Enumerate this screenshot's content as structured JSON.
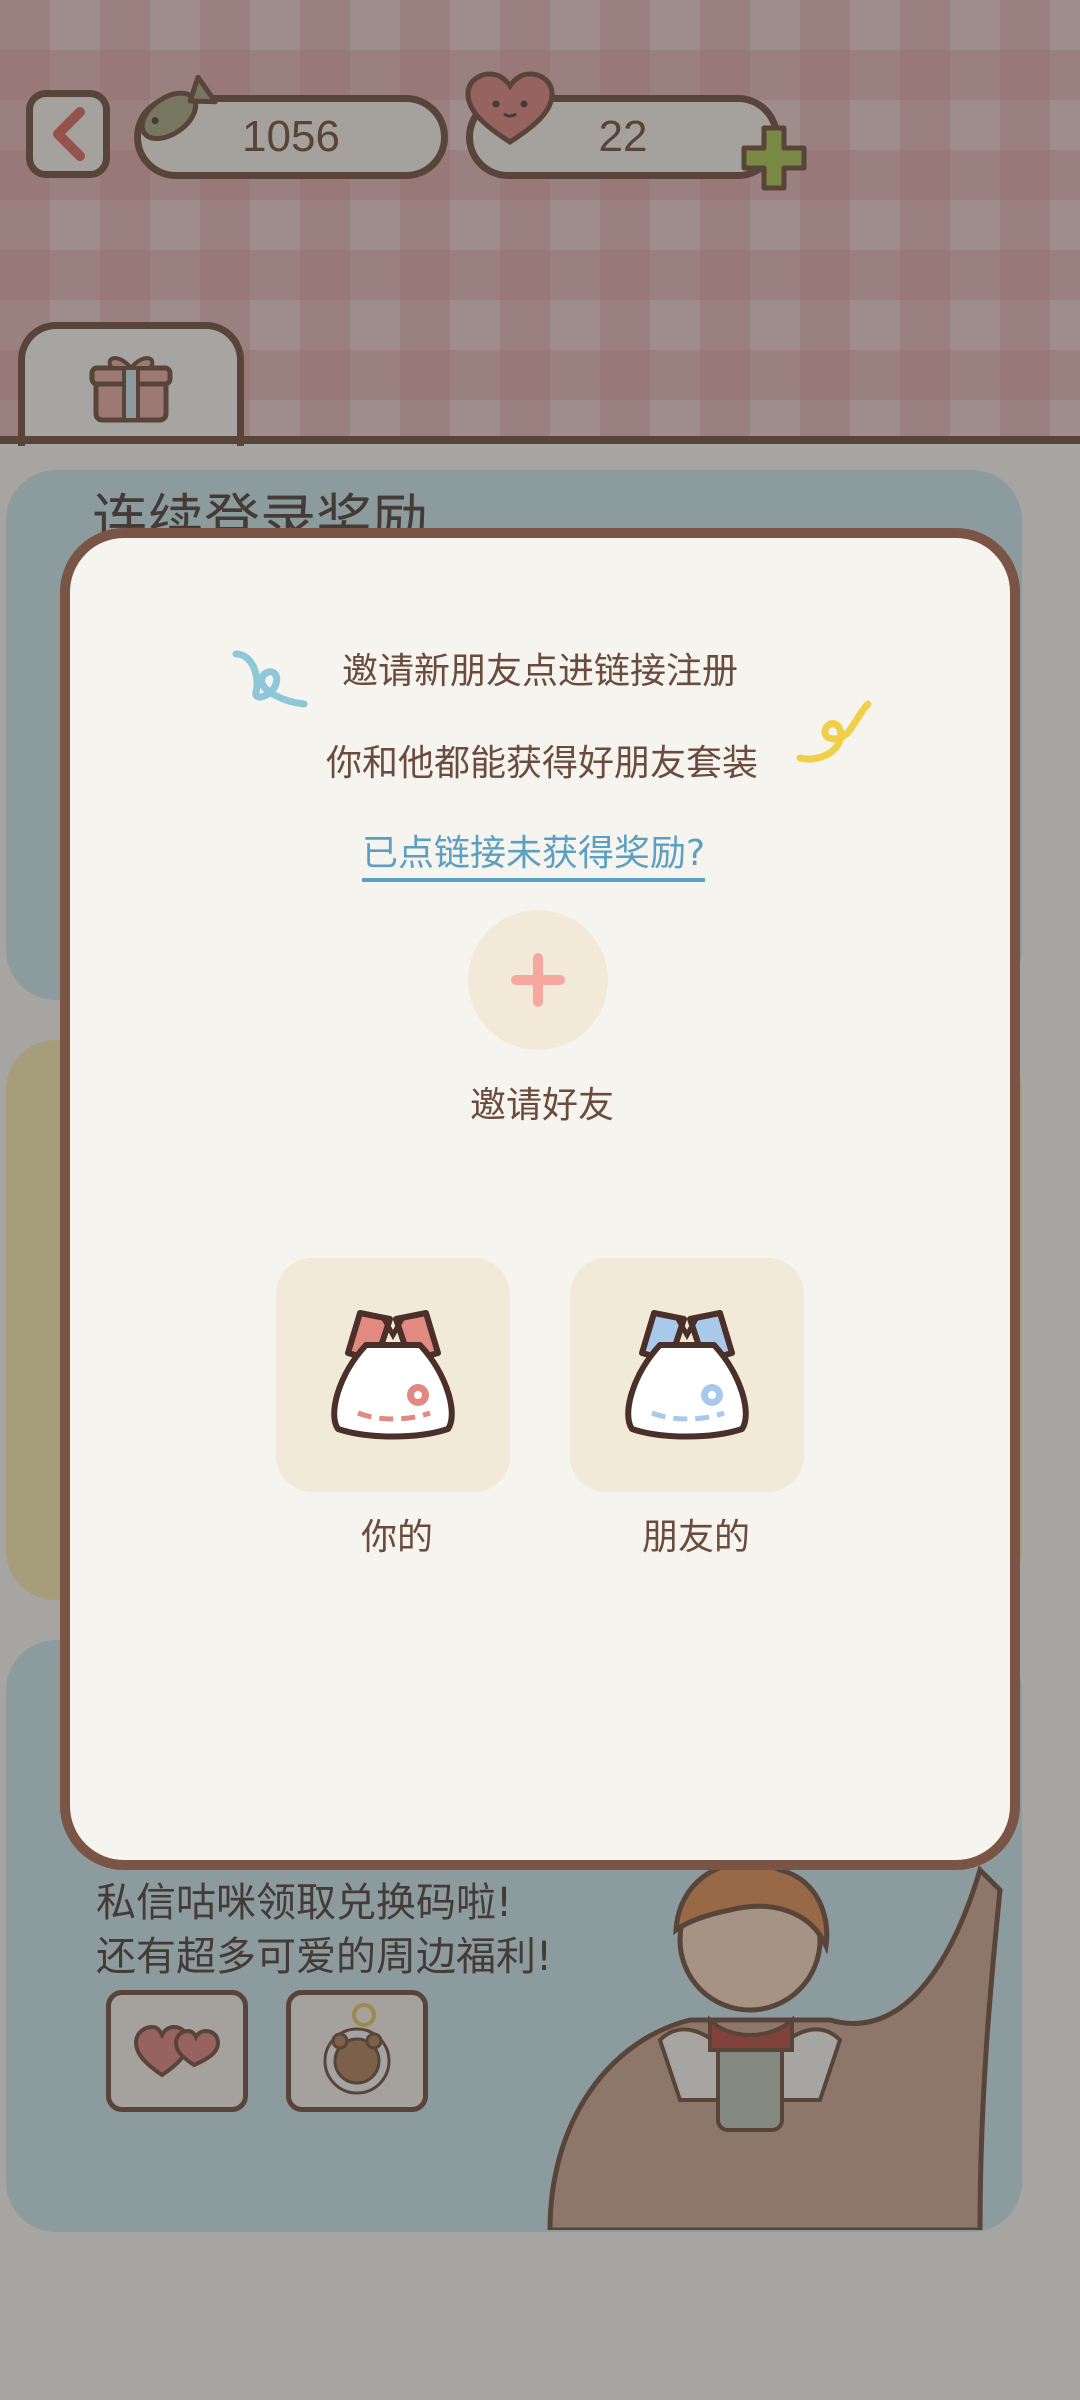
{
  "topbar": {
    "fish_count": "1056",
    "heart_count": "22"
  },
  "tab": {
    "icon": "gift-icon"
  },
  "background": {
    "login_title": "连续登录奖励",
    "promo_line_1": "私信咕咪领取兑换码啦!",
    "promo_line_2": "还有超多可爱的周边福利!"
  },
  "modal": {
    "invite_line_1": "邀请新朋友点进链接注册",
    "invite_line_2": "你和他都能获得好朋友套装",
    "help_link": "已点链接未获得奖励?",
    "invite_button_label": "邀请好友",
    "reward_you_label": "你的",
    "reward_friend_label": "朋友的"
  },
  "colors": {
    "outline": "#6e4a3a",
    "modal_bg": "#f6f4ee",
    "link": "#5b9fc3",
    "plus_pink": "#f6a8a0",
    "plus_green": "#a6c04a"
  }
}
